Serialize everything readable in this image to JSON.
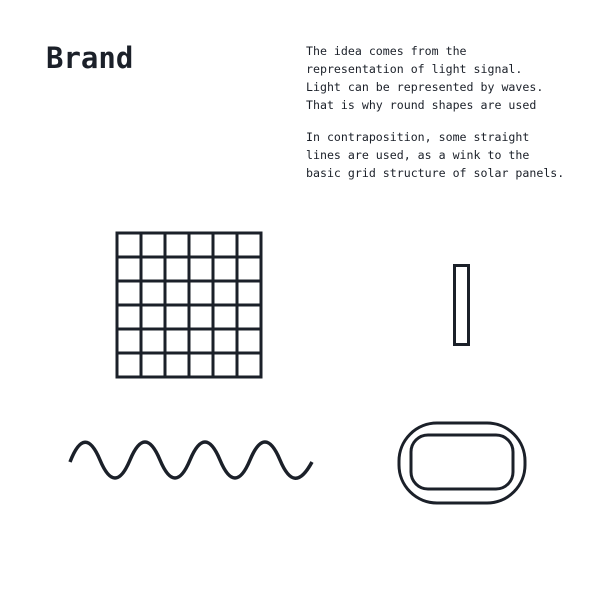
{
  "brand": {
    "title": "Brand",
    "paragraph_1": "The idea comes from the\nrepresentation of light signal.\nLight can be represented by waves.\nThat is why round shapes are used",
    "paragraph_2": "In contraposition, some straight\nlines are used, as a wink to the\nbasic grid structure of solar panels."
  },
  "colors": {
    "ink": "#1b2029",
    "background": "#ffffff"
  },
  "shapes": [
    "grid-icon",
    "bar-icon",
    "wave-icon",
    "rounded-rectangle-icon"
  ]
}
